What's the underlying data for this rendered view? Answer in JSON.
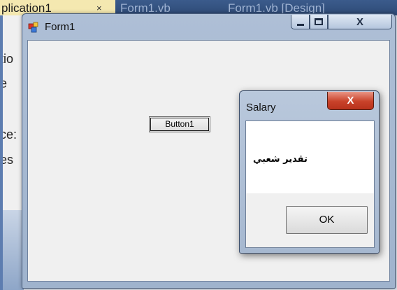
{
  "ide": {
    "tabs": [
      "plication1",
      "Form1.vb",
      "Form1.vb [Design]"
    ],
    "tab_close": "×",
    "left_fragments": [
      "tio",
      "e",
      "ce:",
      "es"
    ]
  },
  "form1": {
    "title": "Form1",
    "close_glyph": "X",
    "button1_label": "Button1"
  },
  "msgbox": {
    "title": "Salary",
    "close_glyph": "X",
    "message": "تقدير شعبي",
    "ok_label": "OK"
  },
  "colors": {
    "tab_active": "#f4e8b0",
    "client_bg": "#f0f0f0",
    "close_red": "#c9422a"
  }
}
